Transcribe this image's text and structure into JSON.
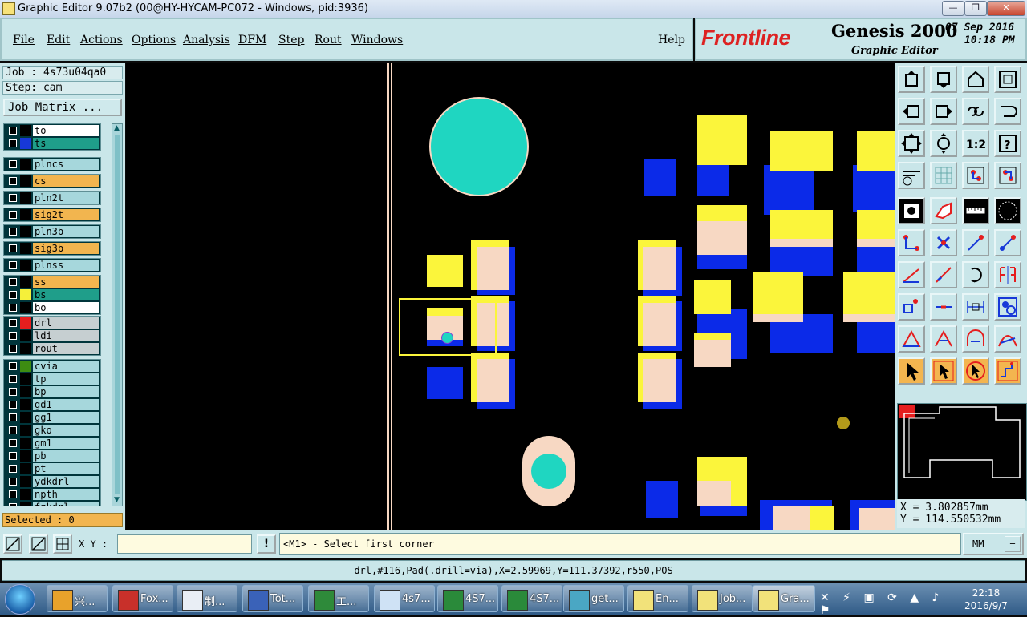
{
  "window": {
    "title": "Graphic Editor 9.07b2 (00@HY-HYCAM-PC072 - Windows, pid:3936)",
    "minimize": "—",
    "restore": "❐",
    "close": "✕"
  },
  "menu": {
    "file": "File",
    "edit": "Edit",
    "actions": "Actions",
    "options": "Options",
    "analysis": "Analysis",
    "dfm": "DFM",
    "step": "Step",
    "rout": "Rout",
    "windows": "Windows",
    "help": "Help"
  },
  "brand": {
    "logo": "Frontline",
    "product": "Genesis 2000",
    "subtitle": "Graphic Editor",
    "date": "07 Sep 2016",
    "time": "10:18 PM"
  },
  "job": {
    "job_label": "Job : 4s73u04qa0",
    "step_label": "Step: cam",
    "job_matrix": "Job Matrix ...",
    "selected": "Selected : 0"
  },
  "layers": [
    {
      "name": "to",
      "color": "#ffffff",
      "swatch": "#000000"
    },
    {
      "name": "ts",
      "color": "#1f9e8a",
      "swatch": "#1738d8"
    },
    {
      "name": "plncs",
      "color": "#a6d7dc",
      "swatch": "#000000"
    },
    {
      "name": "cs",
      "color": "#f2b54f",
      "swatch": "#000000"
    },
    {
      "name": "pln2t",
      "color": "#a6d7dc",
      "swatch": "#000000"
    },
    {
      "name": "sig2t",
      "color": "#f2b54f",
      "swatch": "#000000"
    },
    {
      "name": "pln3b",
      "color": "#a6d7dc",
      "swatch": "#000000"
    },
    {
      "name": "sig3b",
      "color": "#f2b54f",
      "swatch": "#000000"
    },
    {
      "name": "plnss",
      "color": "#a6d7dc",
      "swatch": "#000000"
    },
    {
      "name": "ss",
      "color": "#f2b54f",
      "swatch": "#000000"
    },
    {
      "name": "bs",
      "color": "#1f9e8a",
      "swatch": "#f5f03a"
    },
    {
      "name": "bo",
      "color": "#ffffff",
      "swatch": "#000000"
    },
    {
      "name": "drl",
      "color": "#c6cfd1",
      "swatch": "#e51e1e"
    },
    {
      "name": "ldi",
      "color": "#c6cfd1",
      "swatch": "#000000"
    },
    {
      "name": "rout",
      "color": "#c6cfd1",
      "swatch": "#000000"
    },
    {
      "name": "cvia",
      "color": "#a6d7dc",
      "swatch": "#3d8c12"
    },
    {
      "name": "tp",
      "color": "#a6d7dc",
      "swatch": "#000000"
    },
    {
      "name": "bp",
      "color": "#a6d7dc",
      "swatch": "#000000"
    },
    {
      "name": "gd1",
      "color": "#a6d7dc",
      "swatch": "#000000"
    },
    {
      "name": "gg1",
      "color": "#a6d7dc",
      "swatch": "#000000"
    },
    {
      "name": "gko",
      "color": "#a6d7dc",
      "swatch": "#000000"
    },
    {
      "name": "gm1",
      "color": "#a6d7dc",
      "swatch": "#000000"
    },
    {
      "name": "pb",
      "color": "#a6d7dc",
      "swatch": "#000000"
    },
    {
      "name": "pt",
      "color": "#a6d7dc",
      "swatch": "#000000"
    },
    {
      "name": "ydkdrl",
      "color": "#a6d7dc",
      "swatch": "#000000"
    },
    {
      "name": "npth",
      "color": "#a6d7dc",
      "swatch": "#000000"
    },
    {
      "name": "fzkdrl",
      "color": "#a6d7dc",
      "swatch": "#000000"
    }
  ],
  "coords": {
    "x": "X = 3.802857mm",
    "y": "Y = 114.550532mm"
  },
  "prompt": {
    "xy_label": "X Y :",
    "xy_value": "",
    "warn": "!",
    "message": "<M1> - Select first corner",
    "units": "MM",
    "units_menu": "═"
  },
  "status_text": "drl,#116,Pad(.drill=via),X=2.59969,Y=111.37392,r550,POS",
  "taskbar": {
    "items": [
      "兴...",
      "Fox...",
      "制...",
      "Tot...",
      "工...",
      "4s7...",
      "4S7...",
      "4S7...",
      "get...",
      "En...",
      "Job...",
      "Gra..."
    ],
    "clock_time": "22:18",
    "clock_date": "2016/9/7"
  },
  "colors": {
    "panel": "#c9e6e9",
    "pad_yellow": "#fbf53b",
    "pad_blue": "#0b2ae8",
    "pad_peach": "#f7d8c3",
    "pad_cyan": "#1fd6c1"
  }
}
